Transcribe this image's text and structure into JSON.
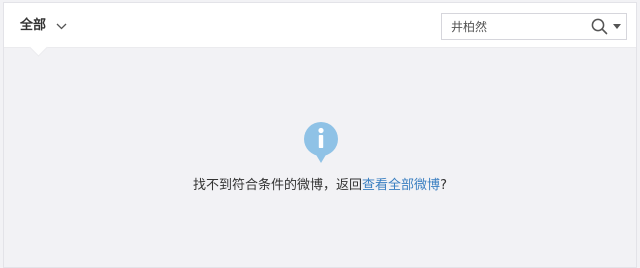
{
  "header": {
    "filter_label": "全部",
    "search": {
      "value": "井柏然"
    }
  },
  "empty_state": {
    "message_prefix": "找不到符合条件的微博，返回",
    "link_text": "查看全部微博",
    "message_suffix": "?"
  },
  "icons": {
    "filter_caret": "chevron-down-icon",
    "search": "search-icon",
    "search_options": "caret-down-icon",
    "info": "info-icon"
  },
  "colors": {
    "link": "#3a7fc1",
    "info_icon": "#8fc2e6",
    "background": "#f2f2f5"
  }
}
